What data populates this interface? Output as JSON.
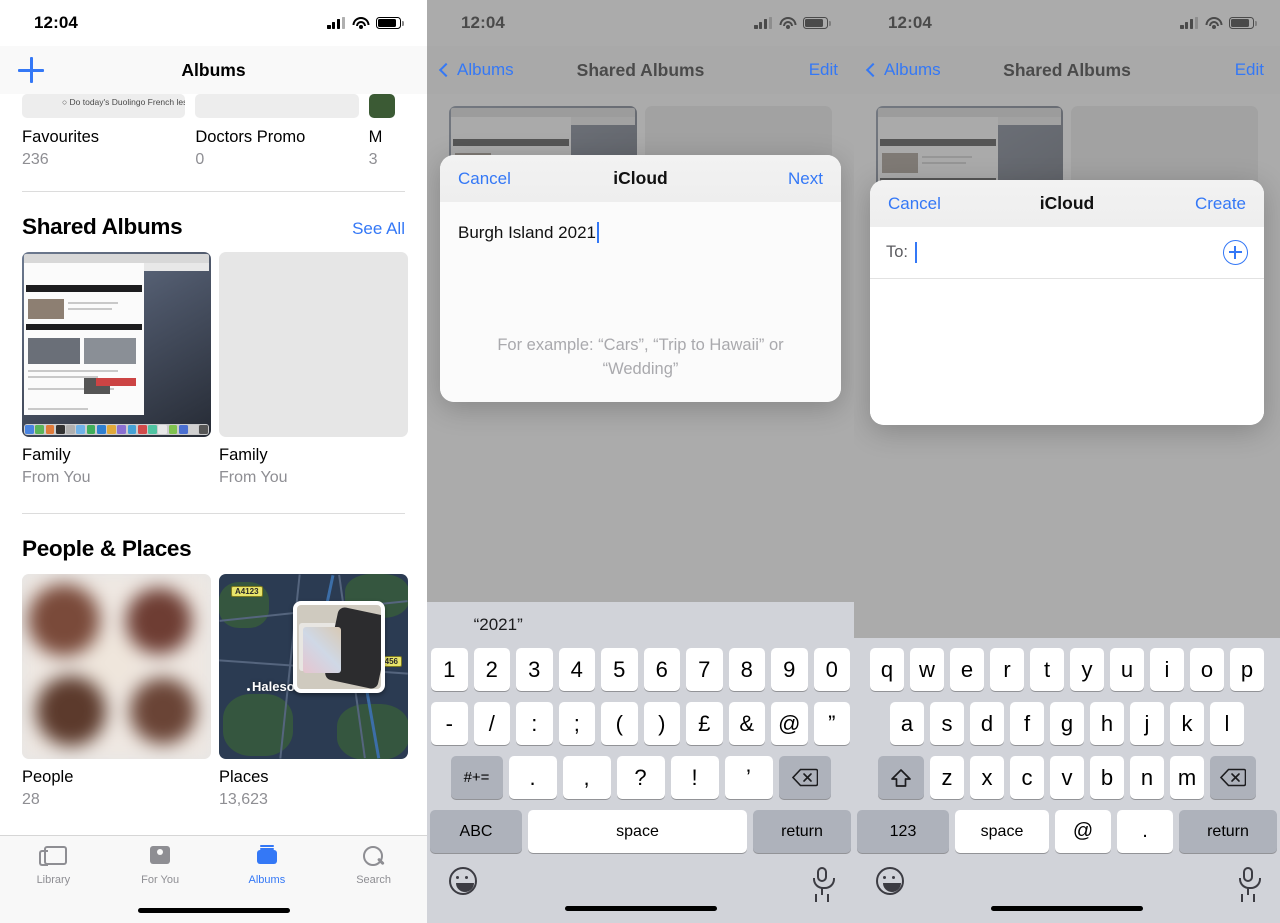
{
  "statusbar": {
    "time": "12:04"
  },
  "left_panel": {
    "nav": {
      "add_icon": "plus-icon",
      "title": "Albums"
    },
    "top_albums": [
      {
        "name": "Favourites",
        "count": "236",
        "thumb_caption": "Do today's Duolingo French lesson"
      },
      {
        "name": "Doctors Promo",
        "count": "0"
      },
      {
        "name": "M",
        "count": "3"
      }
    ],
    "shared_albums": {
      "title": "Shared Albums",
      "see_all": "See All",
      "items": [
        {
          "title": "Family",
          "subtitle": "From You",
          "thumb": "mac-screenshot"
        },
        {
          "title": "Family",
          "subtitle": "From You",
          "thumb": "empty-placeholder"
        }
      ]
    },
    "people_places": {
      "title": "People & Places",
      "items": [
        {
          "title": "People",
          "count": "28",
          "thumb": "blurred-faces"
        },
        {
          "title": "Places",
          "count": "13,623",
          "thumb": "map",
          "map_place": "Halesowen",
          "map_shields": [
            "A4123",
            "A456"
          ]
        }
      ]
    },
    "tabbar": [
      {
        "label": "Library",
        "icon": "photo-stack-icon",
        "active": false
      },
      {
        "label": "For You",
        "icon": "memories-card-icon",
        "active": false
      },
      {
        "label": "Albums",
        "icon": "albums-icon",
        "active": true
      },
      {
        "label": "Search",
        "icon": "search-icon",
        "active": false
      }
    ]
  },
  "mid_panel": {
    "nav": {
      "back": "Albums",
      "title": "Shared Albums",
      "edit": "Edit"
    },
    "dialog": {
      "cancel": "Cancel",
      "title": "iCloud",
      "confirm": "Next",
      "album_name_value": "Burgh Island 2021",
      "hint": "For example: “Cars”, “Trip to Hawaii” or “Wedding”"
    },
    "keyboard": {
      "suggestions": [
        "“2021”",
        "",
        ""
      ],
      "row1": [
        "1",
        "2",
        "3",
        "4",
        "5",
        "6",
        "7",
        "8",
        "9",
        "0"
      ],
      "row2": [
        "-",
        "/",
        ":",
        ";",
        "(",
        ")",
        "£",
        "&",
        "@",
        "”"
      ],
      "row3_left": "#+=",
      "row3": [
        ".",
        ",",
        "?",
        "!",
        "’"
      ],
      "row3_right": "delete-icon",
      "bottom": {
        "abc": "ABC",
        "space": "space",
        "return": "return"
      },
      "emoji_icon": "emoji-icon",
      "mic_icon": "microphone-icon"
    }
  },
  "right_panel": {
    "nav": {
      "back": "Albums",
      "title": "Shared Albums",
      "edit": "Edit"
    },
    "dialog": {
      "cancel": "Cancel",
      "title": "iCloud",
      "confirm": "Create",
      "to_label": "To:",
      "to_value": "",
      "add_contact_icon": "plus-circle-icon"
    },
    "keyboard": {
      "row1": [
        "q",
        "w",
        "e",
        "r",
        "t",
        "y",
        "u",
        "i",
        "o",
        "p"
      ],
      "row2": [
        "a",
        "s",
        "d",
        "f",
        "g",
        "h",
        "j",
        "k",
        "l"
      ],
      "row3_left": "shift-icon",
      "row3": [
        "z",
        "x",
        "c",
        "v",
        "b",
        "n",
        "m"
      ],
      "row3_right": "delete-icon",
      "bottom": {
        "numbers": "123",
        "space": "space",
        "at": "@",
        "dot": ".",
        "return": "return"
      },
      "emoji_icon": "emoji-icon",
      "mic_icon": "microphone-icon"
    }
  },
  "colors": {
    "accent_blue": "#3478f6",
    "secondary_text": "#8e8e93",
    "keyboard_bg": "#d1d3d9",
    "dim_overlay": "#787878"
  }
}
